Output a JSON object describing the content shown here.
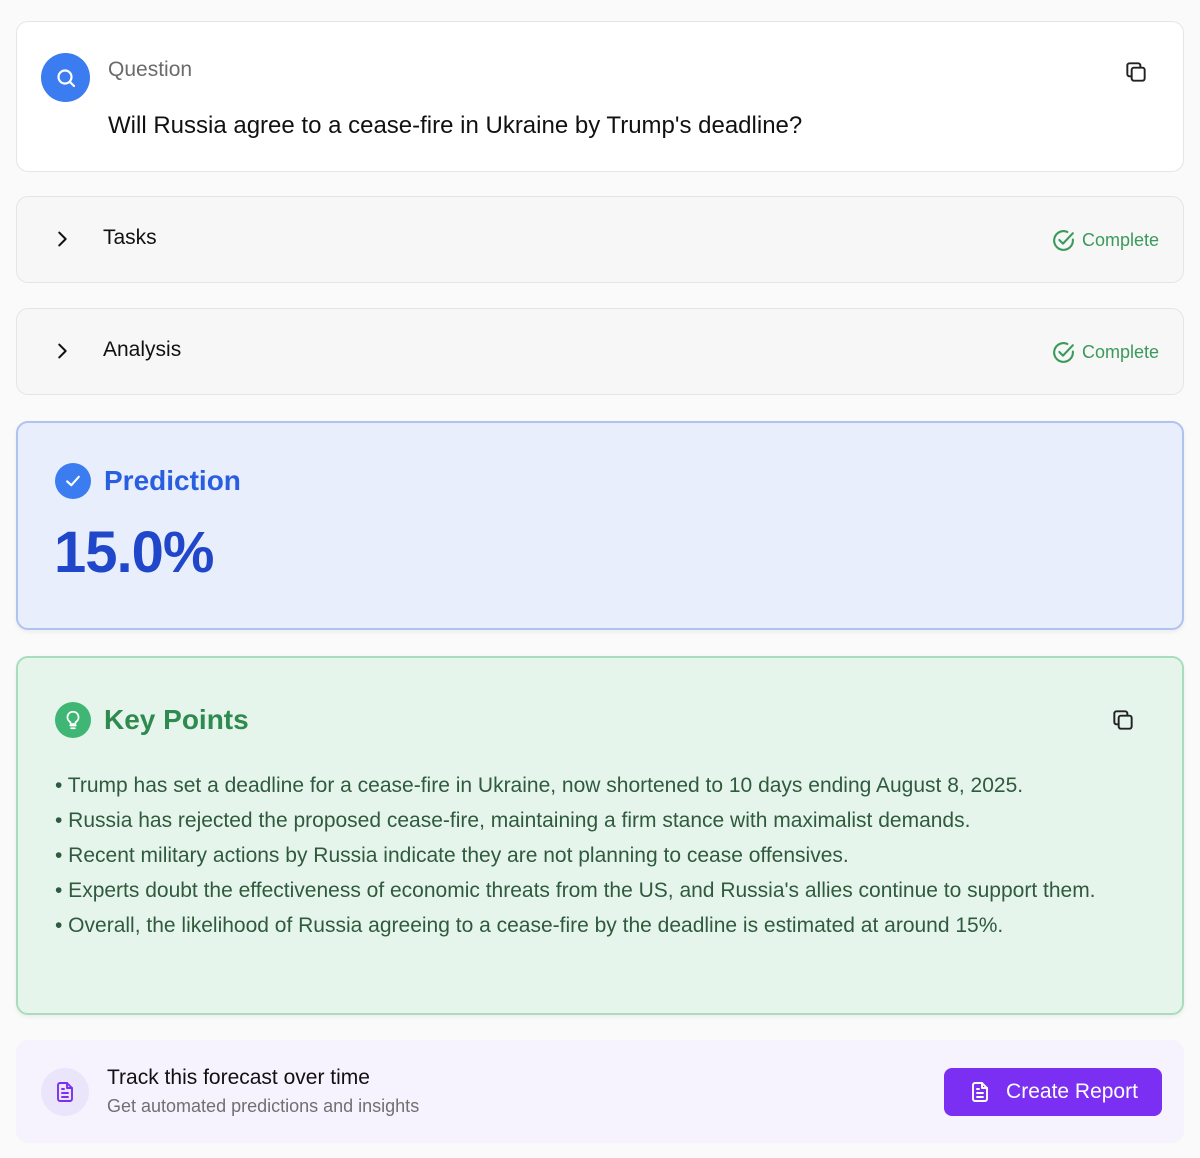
{
  "question": {
    "label": "Question",
    "text": "Will Russia agree to a cease-fire in Ukraine by Trump's deadline?"
  },
  "sections": [
    {
      "label": "Tasks",
      "status": "Complete"
    },
    {
      "label": "Analysis",
      "status": "Complete"
    }
  ],
  "prediction": {
    "title": "Prediction",
    "value": "15.0%"
  },
  "key_points": {
    "title": "Key Points",
    "items": [
      "• Trump has set a deadline for a cease-fire in Ukraine, now shortened to 10 days ending August 8, 2025.",
      "• Russia has rejected the proposed cease-fire, maintaining a firm stance with maximalist demands.",
      "• Recent military actions by Russia indicate they are not planning to cease offensives.",
      "• Experts doubt the effectiveness of economic threats from the US, and Russia's allies continue to support them.",
      "• Overall, the likelihood of Russia agreeing to a cease-fire by the deadline is estimated at around 15%."
    ]
  },
  "track": {
    "title": "Track this forecast over time",
    "subtitle": "Get automated predictions and insights",
    "button_label": "Create Report"
  },
  "icons": {
    "question": "search-icon",
    "copy": "copy-icon",
    "expand": "chevron-right-icon",
    "status": "check-circle-icon",
    "prediction": "check-icon",
    "key_points": "lightbulb-icon",
    "report": "document-icon"
  },
  "colors": {
    "accent_blue": "#3b7cf0",
    "prediction_text": "#2047c9",
    "complete_green": "#3a9a5a",
    "key_points_green": "#2e8a4e",
    "create_button": "#7b2ff2"
  }
}
